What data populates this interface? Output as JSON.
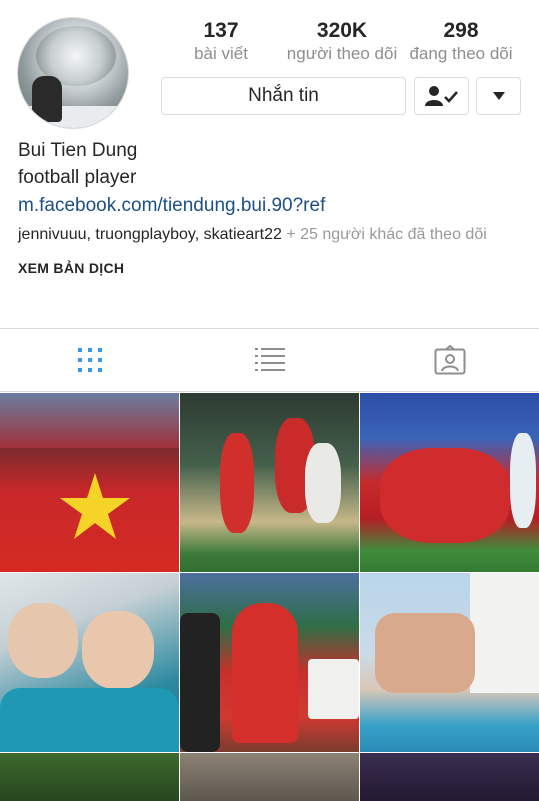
{
  "stats": {
    "posts": {
      "value": "137",
      "label": "bài viết"
    },
    "followers": {
      "value": "320K",
      "label": "người theo dõi"
    },
    "following": {
      "value": "298",
      "label": "đang theo dõi"
    }
  },
  "buttons": {
    "message_label": "Nhắn tin"
  },
  "bio": {
    "name": "Bui Tien Dung",
    "role": "football player",
    "link": "m.facebook.com/tiendung.bui.90?ref",
    "followed_users": [
      "jennivuuu",
      "truongplayboy",
      "skatieart22"
    ],
    "followed_separator": ", ",
    "followed_suffix": " + 25 người khác đã theo dõi",
    "translate_label": "XEM BẢN DỊCH"
  },
  "tabs": [
    {
      "icon": "grid-icon",
      "active": true
    },
    {
      "icon": "list-icon",
      "active": false
    },
    {
      "icon": "tagged-icon",
      "active": false
    }
  ],
  "colors": {
    "active_tab": "#3897f0",
    "link": "#1d4f86",
    "muted": "#8e8e8e"
  }
}
